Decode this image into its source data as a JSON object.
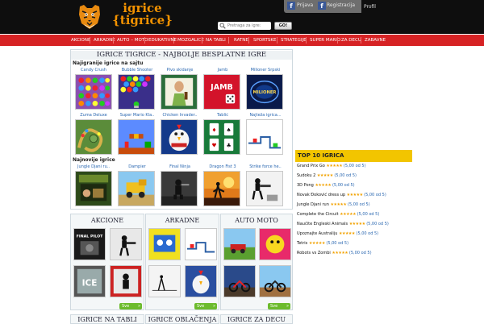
{
  "header": {
    "logo_line1": "igrice",
    "logo_line2": "{tigrice}",
    "search_placeholder": "Pretraga za igre:",
    "search_button": "GO!",
    "login": "Prijava",
    "register": "Registracija",
    "profile": "Profil"
  },
  "nav": [
    "AKCIONE",
    "ARKADNE",
    "AUTO – MOTO",
    "EDUKATIVNE",
    "MOZGALICE",
    "NA TABLI",
    "RATNE",
    "SPORTSKE",
    "STRATEGIJE",
    "SUPER MARIO",
    "ZA DECU",
    "ZABAVNE"
  ],
  "main": {
    "title": "IGRICE TIGRICE - NAJBOLJE BESPLATNE IGRE",
    "popular_heading": "Najigranije igrice na sajtu",
    "popular": [
      "Candy Crush",
      "Bubble Shooter",
      "Pivo skidanje",
      "Jamb",
      "Milioner Srpski",
      "Zuma Deluxe",
      "Super Mario Kla..",
      "Chicken Invader..",
      "Tablić",
      "Najteža igrica..."
    ],
    "newest_heading": "Najnovije igrice",
    "newest": [
      "Jungle Djani ru..",
      "Dampier",
      "Final Ninja",
      "Dragon Fist 3",
      "Strike force he.."
    ],
    "jamb_text": "JAMB",
    "milioner_text": "MILIONER"
  },
  "categories": [
    {
      "title": "AKCIONE",
      "more": "Sve"
    },
    {
      "title": "ARKADNE",
      "more": "Sve"
    },
    {
      "title": "AUTO MOTO",
      "more": "Sve"
    }
  ],
  "category_thumb_texts": {
    "final_pilot": "FINAL PILOT",
    "ice": "ICE"
  },
  "bottom_titles": [
    "IGRICE NA TABLI",
    "IGRICE OBLAČENJA",
    "IGRICE ZA DECU"
  ],
  "top10": {
    "title": "TOP 10 IGRICA",
    "stars": "★★★★★",
    "items": [
      {
        "name": "Grand Prix Go",
        "rating": "(5,00 od 5)"
      },
      {
        "name": "Sudoku 2",
        "rating": "(5,00 od 5)"
      },
      {
        "name": "3D Pong",
        "rating": "(5,00 od 5)"
      },
      {
        "name": "Novak Đoković dress up",
        "rating": "(5,00 od 5)"
      },
      {
        "name": "Jungle Djani run",
        "rating": "(5,00 od 5)"
      },
      {
        "name": "Complete the Circuit",
        "rating": "(5,00 od 5)"
      },
      {
        "name": "Naučite Engleski Animals",
        "rating": "(5,00 od 5)"
      },
      {
        "name": "Upoznajte Australiju",
        "rating": "(5,00 od 5)"
      },
      {
        "name": "Tetris",
        "rating": "(5,00 od 5)"
      },
      {
        "name": "Robots vs Zombi",
        "rating": "(5,00 od 5)"
      }
    ]
  },
  "colors": {
    "header_bg": "#0e0e0e",
    "nav_bg": "#d62224",
    "logo_orange": "#f29200",
    "top10_yellow": "#f2c500",
    "link_blue": "#2866b0",
    "more_green": "#6cbb2d"
  }
}
